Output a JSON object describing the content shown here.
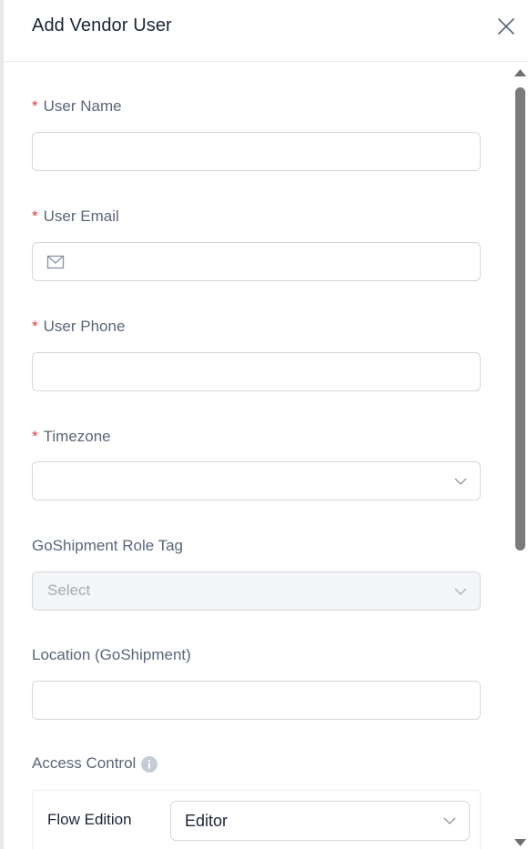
{
  "dialog": {
    "title": "Add Vendor User"
  },
  "form": {
    "required_marker": "*",
    "user_name": {
      "label": "User Name",
      "value": ""
    },
    "user_email": {
      "label": "User Email",
      "value": "",
      "icon": "mail-icon"
    },
    "user_phone": {
      "label": "User Phone",
      "value": ""
    },
    "timezone": {
      "label": "Timezone",
      "value": ""
    },
    "role_tag": {
      "label": "GoShipment Role Tag",
      "placeholder": "Select",
      "disabled": true
    },
    "location": {
      "label": "Location (GoShipment)",
      "value": ""
    },
    "access_control": {
      "label": "Access Control",
      "icon": "info-icon",
      "rows": [
        {
          "label": "Flow Edition",
          "value": "Editor"
        }
      ]
    }
  },
  "colors": {
    "required": "#e23c3c",
    "label": "#5b6679",
    "border": "#d3d7de",
    "scrollbar_thumb": "#7b7b7b"
  }
}
